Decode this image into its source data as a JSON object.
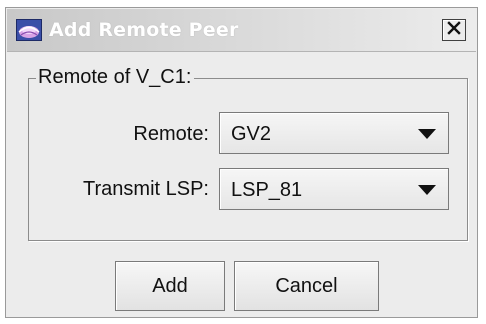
{
  "window": {
    "title": "Add Remote Peer",
    "app_icon": "globe-icon",
    "close_icon": "close-icon"
  },
  "group": {
    "legend": "Remote of V_C1:"
  },
  "fields": {
    "remote": {
      "label": "Remote:",
      "value": "GV2",
      "dropdown_icon": "triangle-down-icon"
    },
    "transmit_lsp": {
      "label": "Transmit LSP:",
      "value": "LSP_81",
      "dropdown_icon": "triangle-down-icon"
    }
  },
  "buttons": {
    "add": "Add",
    "cancel": "Cancel"
  }
}
